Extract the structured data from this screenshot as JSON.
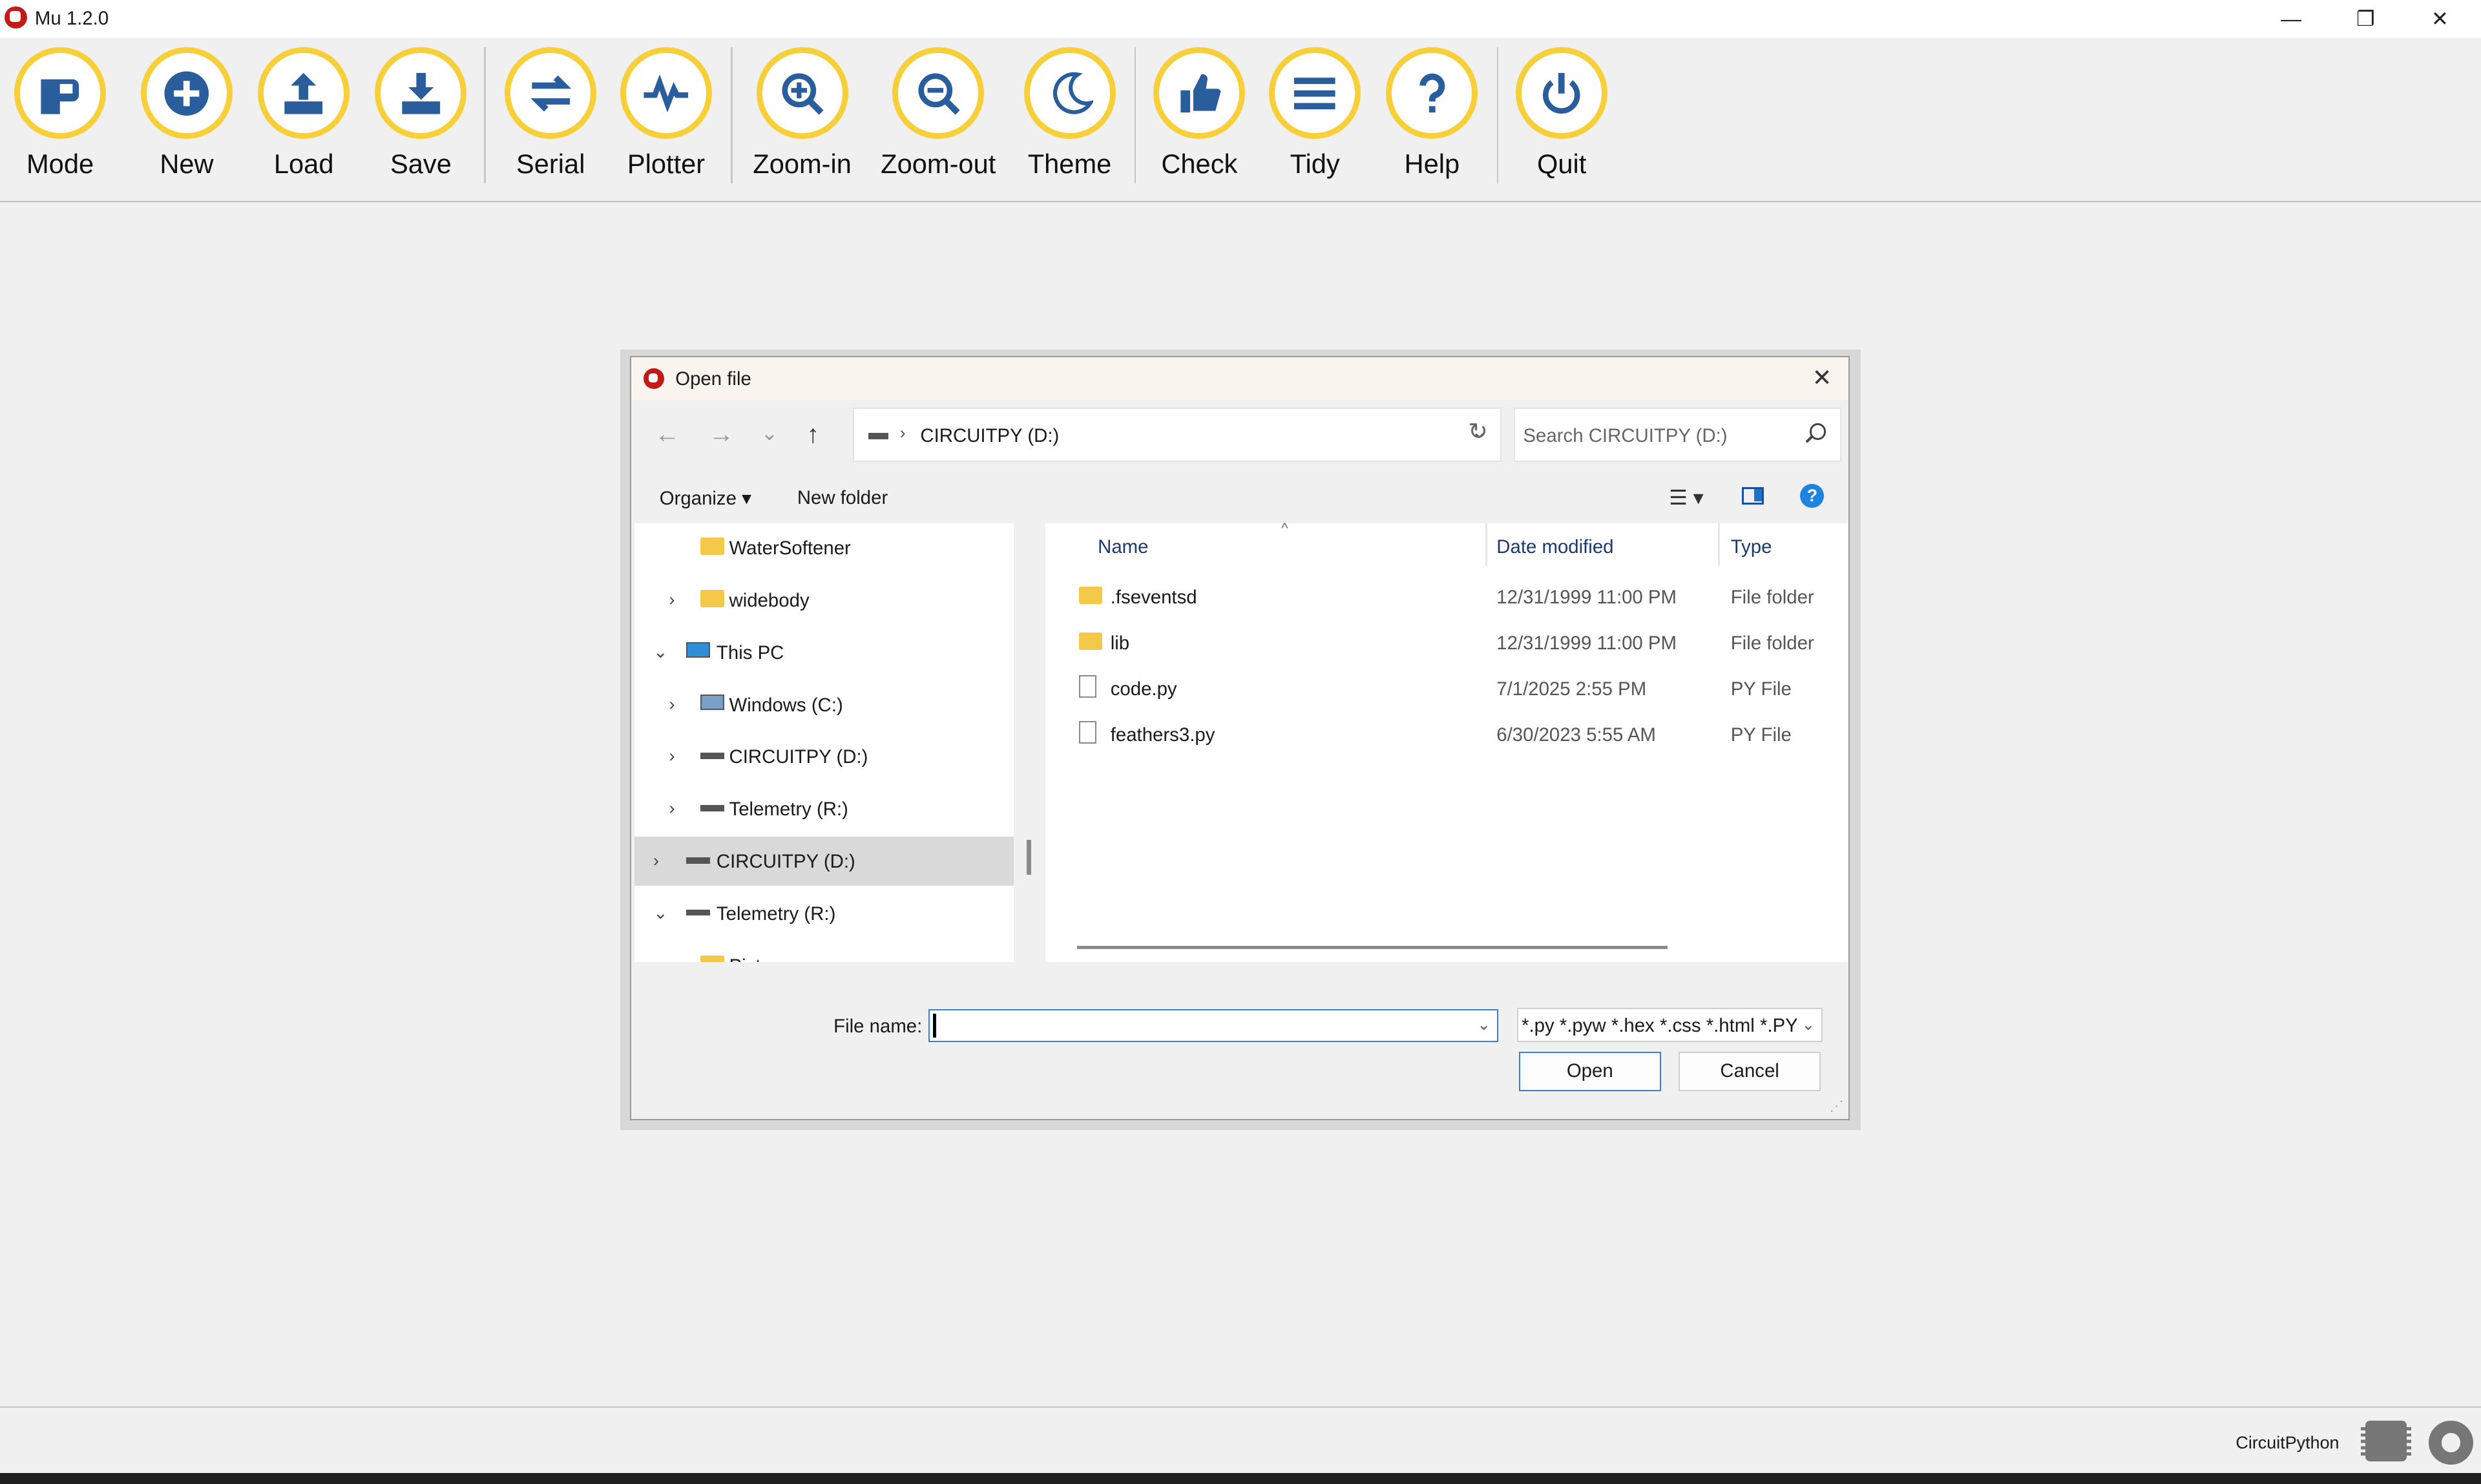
{
  "window": {
    "title": "Mu 1.2.0",
    "controls": {
      "minimize": "—",
      "restore": "❐",
      "close": "✕"
    }
  },
  "toolbar": {
    "buttons": [
      {
        "label": "Mode",
        "icon": "mode-icon"
      },
      {
        "label": "New",
        "icon": "plus-icon"
      },
      {
        "label": "Load",
        "icon": "upload-icon"
      },
      {
        "label": "Save",
        "icon": "download-icon"
      },
      {
        "label": "Serial",
        "icon": "arrows-icon"
      },
      {
        "label": "Plotter",
        "icon": "pulse-icon"
      },
      {
        "label": "Zoom-in",
        "icon": "zoom-in-icon"
      },
      {
        "label": "Zoom-out",
        "icon": "zoom-out-icon"
      },
      {
        "label": "Theme",
        "icon": "moon-icon"
      },
      {
        "label": "Check",
        "icon": "thumbs-up-icon"
      },
      {
        "label": "Tidy",
        "icon": "lines-icon"
      },
      {
        "label": "Help",
        "icon": "question-icon"
      },
      {
        "label": "Quit",
        "icon": "power-icon"
      }
    ],
    "accent_color": "#f7cf3a",
    "icon_color": "#2a5d9c"
  },
  "dialog": {
    "title": "Open file",
    "close": "✕",
    "nav": {
      "back": "←",
      "forward": "→",
      "recent": "⌄",
      "up": "↑"
    },
    "path": {
      "separator": "›",
      "current": "CIRCUITPY (D:)",
      "dropdown": "⌄"
    },
    "refresh": "↻",
    "search": {
      "placeholder": "Search CIRCUITPY (D:)"
    },
    "commands": {
      "organize": "Organize ▾",
      "new_folder": "New folder",
      "view": "☰ ▾",
      "help": "?"
    },
    "tree": [
      {
        "label": "WaterSoftener",
        "icon": "folder-icon",
        "expander": ""
      },
      {
        "label": "widebody",
        "icon": "folder-icon",
        "expander": "›"
      },
      {
        "label": "This PC",
        "icon": "computer-icon",
        "expander": "⌄"
      },
      {
        "label": "Windows  (C:)",
        "icon": "windows-drive-icon",
        "expander": "›"
      },
      {
        "label": "CIRCUITPY (D:)",
        "icon": "drive-icon",
        "expander": "›"
      },
      {
        "label": "Telemetry (R:)",
        "icon": "drive-icon",
        "expander": "›"
      },
      {
        "label": "CIRCUITPY (D:)",
        "icon": "drive-icon",
        "expander": "›"
      },
      {
        "label": "Telemetry (R:)",
        "icon": "drive-icon",
        "expander": "⌄"
      },
      {
        "label": "Pictures",
        "icon": "folder-icon",
        "expander": "›"
      }
    ],
    "columns": {
      "name": "Name",
      "date": "Date modified",
      "type": "Type",
      "sort_indicator": "^"
    },
    "files": [
      {
        "name": ".fseventsd",
        "date": "12/31/1999 11:00 PM",
        "type": "File folder",
        "icon": "folder-icon"
      },
      {
        "name": "lib",
        "date": "12/31/1999 11:00 PM",
        "type": "File folder",
        "icon": "folder-icon"
      },
      {
        "name": "code.py",
        "date": "7/1/2025 2:55 PM",
        "type": "PY File",
        "icon": "file-icon"
      },
      {
        "name": "feathers3.py",
        "date": "6/30/2023 5:55 AM",
        "type": "PY File",
        "icon": "file-icon"
      }
    ],
    "file_name_label": "File name:",
    "file_name_value": "",
    "filter": "*.py *.pyw *.hex *.css *.html *.PY",
    "open_label": "Open",
    "cancel_label": "Cancel"
  },
  "status": {
    "mode": "CircuitPython"
  }
}
